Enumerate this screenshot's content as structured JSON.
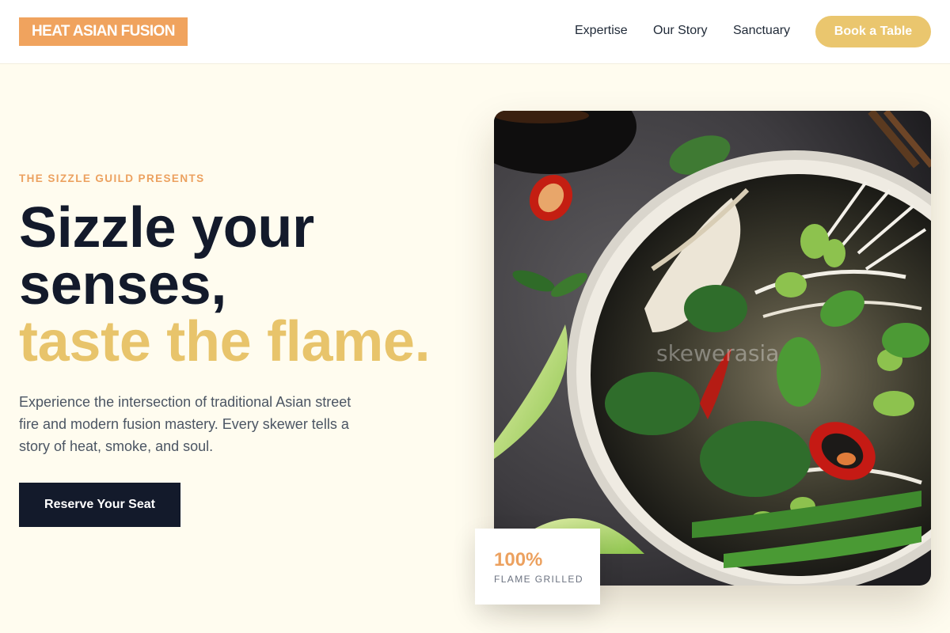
{
  "header": {
    "logo": "HEAT ASIAN FUSION",
    "nav": {
      "expertise": "Expertise",
      "story": "Our Story",
      "sanctuary": "Sanctuary"
    },
    "cta": "Book a Table"
  },
  "hero": {
    "eyebrow": "THE SIZZLE GUILD PRESENTS",
    "headline_line1": "Sizzle your",
    "headline_line2": "senses,",
    "headline_accent": "taste the flame.",
    "description": "Experience the intersection of traditional Asian street fire and modern fusion mastery. Every skewer tells a story of heat, smoke, and soul.",
    "button": "Reserve Your Seat",
    "image_icon": "noodle-bowl-photo",
    "image_watermark": "skewerasia"
  },
  "stat": {
    "value": "100%",
    "label": "FLAME GRILLED"
  },
  "colors": {
    "background": "#fffcef",
    "logo_bg": "#f0a35e",
    "accent_gold": "#e8c46b",
    "accent_orange": "#eca15f",
    "navy": "#131a2b"
  }
}
